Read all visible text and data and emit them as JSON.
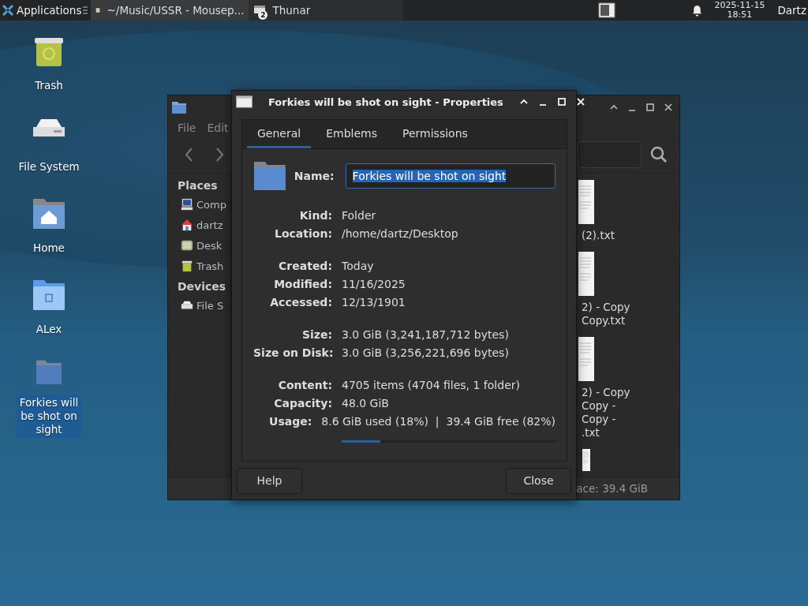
{
  "taskbar": {
    "menu_label": "Applications",
    "tasks": [
      {
        "title": "~/Music/USSR - Mousep...",
        "kind": "editor",
        "selected": true
      },
      {
        "title": "Thunar",
        "kind": "files",
        "count": "2",
        "selected": false
      }
    ],
    "clock": {
      "date": "2025-11-15",
      "time": "18:51"
    },
    "user": "Dartz"
  },
  "desktop_icons": [
    {
      "label": "Trash",
      "kind": "trash",
      "selected": false
    },
    {
      "label": "File System",
      "kind": "drive",
      "selected": false
    },
    {
      "label": "Home",
      "kind": "home",
      "selected": false
    },
    {
      "label": "ALex",
      "kind": "bluefolder",
      "selected": false
    },
    {
      "label": "Forkies will be shot on sight",
      "kind": "folder",
      "selected": true
    }
  ],
  "file_manager": {
    "menu": [
      "File",
      "Edit"
    ],
    "sidebar": [
      {
        "heading": "Places",
        "items": [
          {
            "label": "Comp",
            "kind": "computer"
          },
          {
            "label": "dartz",
            "kind": "home"
          },
          {
            "label": "Desk",
            "kind": "desktop"
          },
          {
            "label": "Trash",
            "kind": "trash"
          }
        ]
      },
      {
        "heading": "Devices",
        "items": [
          {
            "label": "File S",
            "kind": "drive"
          }
        ]
      }
    ],
    "files": [
      {
        "kind": "document",
        "lines": [
          "(2).txt"
        ]
      },
      {
        "kind": "document",
        "lines": [
          "2) - Copy",
          "Copy.txt"
        ]
      },
      {
        "kind": "document",
        "lines": [
          "2) - Copy",
          "Copy -",
          "Copy -",
          ".txt"
        ]
      },
      {
        "kind": "document"
      }
    ],
    "status": "ace: 39.4 GiB"
  },
  "dialog": {
    "title": "Forkies will be shot on sight - Properties",
    "tabs": [
      {
        "label": "General",
        "selected": true
      },
      {
        "label": "Emblems",
        "selected": false
      },
      {
        "label": "Permissions",
        "selected": false
      }
    ],
    "name_label": "Name:",
    "name_value": "Forkies will be shot on sight",
    "name_highlighted": true,
    "groups": [
      [
        {
          "label": "Kind:",
          "value": "Folder"
        },
        {
          "label": "Location:",
          "value": "/home/dartz/Desktop"
        }
      ],
      [
        {
          "label": "Created:",
          "value": "Today"
        },
        {
          "label": "Modified:",
          "value": "11/16/2025"
        },
        {
          "label": "Accessed:",
          "value": "12/13/1901"
        }
      ],
      [
        {
          "label": "Size:",
          "value": "3.0 GiB (3,241,187,712 bytes)"
        },
        {
          "label": "Size on Disk:",
          "value": "3.0 GiB (3,256,221,696 bytes)"
        }
      ],
      [
        {
          "label": "Content:",
          "value": "4705 items (4704 files, 1 folder)"
        },
        {
          "label": "Capacity:",
          "value": "48.0 GiB"
        },
        {
          "label": "Usage:",
          "value": "8.6 GiB used (18%)  |  39.4 GiB free (82%)"
        }
      ]
    ],
    "usage": {
      "level": 0.18
    },
    "buttons": [
      "Help",
      "Close"
    ]
  }
}
